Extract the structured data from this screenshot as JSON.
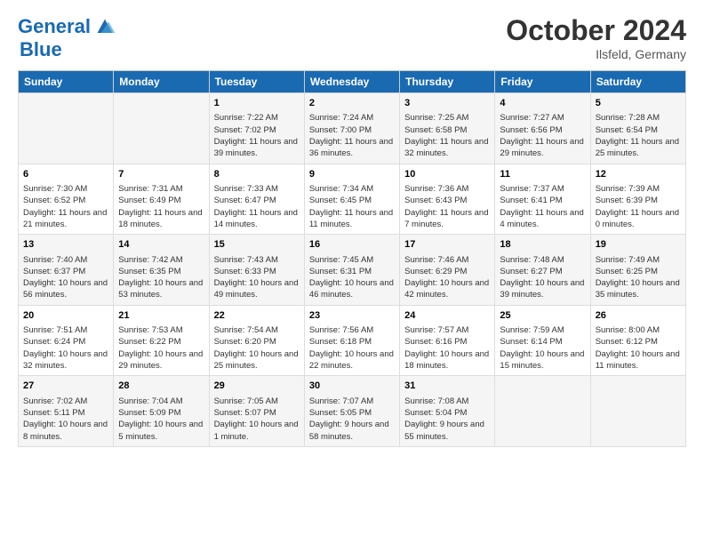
{
  "logo": {
    "line1": "General",
    "line2": "Blue"
  },
  "title": "October 2024",
  "location": "Ilsfeld, Germany",
  "days_of_week": [
    "Sunday",
    "Monday",
    "Tuesday",
    "Wednesday",
    "Thursday",
    "Friday",
    "Saturday"
  ],
  "weeks": [
    [
      {
        "day": "",
        "info": ""
      },
      {
        "day": "",
        "info": ""
      },
      {
        "day": "1",
        "info": "Sunrise: 7:22 AM\nSunset: 7:02 PM\nDaylight: 11 hours and 39 minutes."
      },
      {
        "day": "2",
        "info": "Sunrise: 7:24 AM\nSunset: 7:00 PM\nDaylight: 11 hours and 36 minutes."
      },
      {
        "day": "3",
        "info": "Sunrise: 7:25 AM\nSunset: 6:58 PM\nDaylight: 11 hours and 32 minutes."
      },
      {
        "day": "4",
        "info": "Sunrise: 7:27 AM\nSunset: 6:56 PM\nDaylight: 11 hours and 29 minutes."
      },
      {
        "day": "5",
        "info": "Sunrise: 7:28 AM\nSunset: 6:54 PM\nDaylight: 11 hours and 25 minutes."
      }
    ],
    [
      {
        "day": "6",
        "info": "Sunrise: 7:30 AM\nSunset: 6:52 PM\nDaylight: 11 hours and 21 minutes."
      },
      {
        "day": "7",
        "info": "Sunrise: 7:31 AM\nSunset: 6:49 PM\nDaylight: 11 hours and 18 minutes."
      },
      {
        "day": "8",
        "info": "Sunrise: 7:33 AM\nSunset: 6:47 PM\nDaylight: 11 hours and 14 minutes."
      },
      {
        "day": "9",
        "info": "Sunrise: 7:34 AM\nSunset: 6:45 PM\nDaylight: 11 hours and 11 minutes."
      },
      {
        "day": "10",
        "info": "Sunrise: 7:36 AM\nSunset: 6:43 PM\nDaylight: 11 hours and 7 minutes."
      },
      {
        "day": "11",
        "info": "Sunrise: 7:37 AM\nSunset: 6:41 PM\nDaylight: 11 hours and 4 minutes."
      },
      {
        "day": "12",
        "info": "Sunrise: 7:39 AM\nSunset: 6:39 PM\nDaylight: 11 hours and 0 minutes."
      }
    ],
    [
      {
        "day": "13",
        "info": "Sunrise: 7:40 AM\nSunset: 6:37 PM\nDaylight: 10 hours and 56 minutes."
      },
      {
        "day": "14",
        "info": "Sunrise: 7:42 AM\nSunset: 6:35 PM\nDaylight: 10 hours and 53 minutes."
      },
      {
        "day": "15",
        "info": "Sunrise: 7:43 AM\nSunset: 6:33 PM\nDaylight: 10 hours and 49 minutes."
      },
      {
        "day": "16",
        "info": "Sunrise: 7:45 AM\nSunset: 6:31 PM\nDaylight: 10 hours and 46 minutes."
      },
      {
        "day": "17",
        "info": "Sunrise: 7:46 AM\nSunset: 6:29 PM\nDaylight: 10 hours and 42 minutes."
      },
      {
        "day": "18",
        "info": "Sunrise: 7:48 AM\nSunset: 6:27 PM\nDaylight: 10 hours and 39 minutes."
      },
      {
        "day": "19",
        "info": "Sunrise: 7:49 AM\nSunset: 6:25 PM\nDaylight: 10 hours and 35 minutes."
      }
    ],
    [
      {
        "day": "20",
        "info": "Sunrise: 7:51 AM\nSunset: 6:24 PM\nDaylight: 10 hours and 32 minutes."
      },
      {
        "day": "21",
        "info": "Sunrise: 7:53 AM\nSunset: 6:22 PM\nDaylight: 10 hours and 29 minutes."
      },
      {
        "day": "22",
        "info": "Sunrise: 7:54 AM\nSunset: 6:20 PM\nDaylight: 10 hours and 25 minutes."
      },
      {
        "day": "23",
        "info": "Sunrise: 7:56 AM\nSunset: 6:18 PM\nDaylight: 10 hours and 22 minutes."
      },
      {
        "day": "24",
        "info": "Sunrise: 7:57 AM\nSunset: 6:16 PM\nDaylight: 10 hours and 18 minutes."
      },
      {
        "day": "25",
        "info": "Sunrise: 7:59 AM\nSunset: 6:14 PM\nDaylight: 10 hours and 15 minutes."
      },
      {
        "day": "26",
        "info": "Sunrise: 8:00 AM\nSunset: 6:12 PM\nDaylight: 10 hours and 11 minutes."
      }
    ],
    [
      {
        "day": "27",
        "info": "Sunrise: 7:02 AM\nSunset: 5:11 PM\nDaylight: 10 hours and 8 minutes."
      },
      {
        "day": "28",
        "info": "Sunrise: 7:04 AM\nSunset: 5:09 PM\nDaylight: 10 hours and 5 minutes."
      },
      {
        "day": "29",
        "info": "Sunrise: 7:05 AM\nSunset: 5:07 PM\nDaylight: 10 hours and 1 minute."
      },
      {
        "day": "30",
        "info": "Sunrise: 7:07 AM\nSunset: 5:05 PM\nDaylight: 9 hours and 58 minutes."
      },
      {
        "day": "31",
        "info": "Sunrise: 7:08 AM\nSunset: 5:04 PM\nDaylight: 9 hours and 55 minutes."
      },
      {
        "day": "",
        "info": ""
      },
      {
        "day": "",
        "info": ""
      }
    ]
  ]
}
